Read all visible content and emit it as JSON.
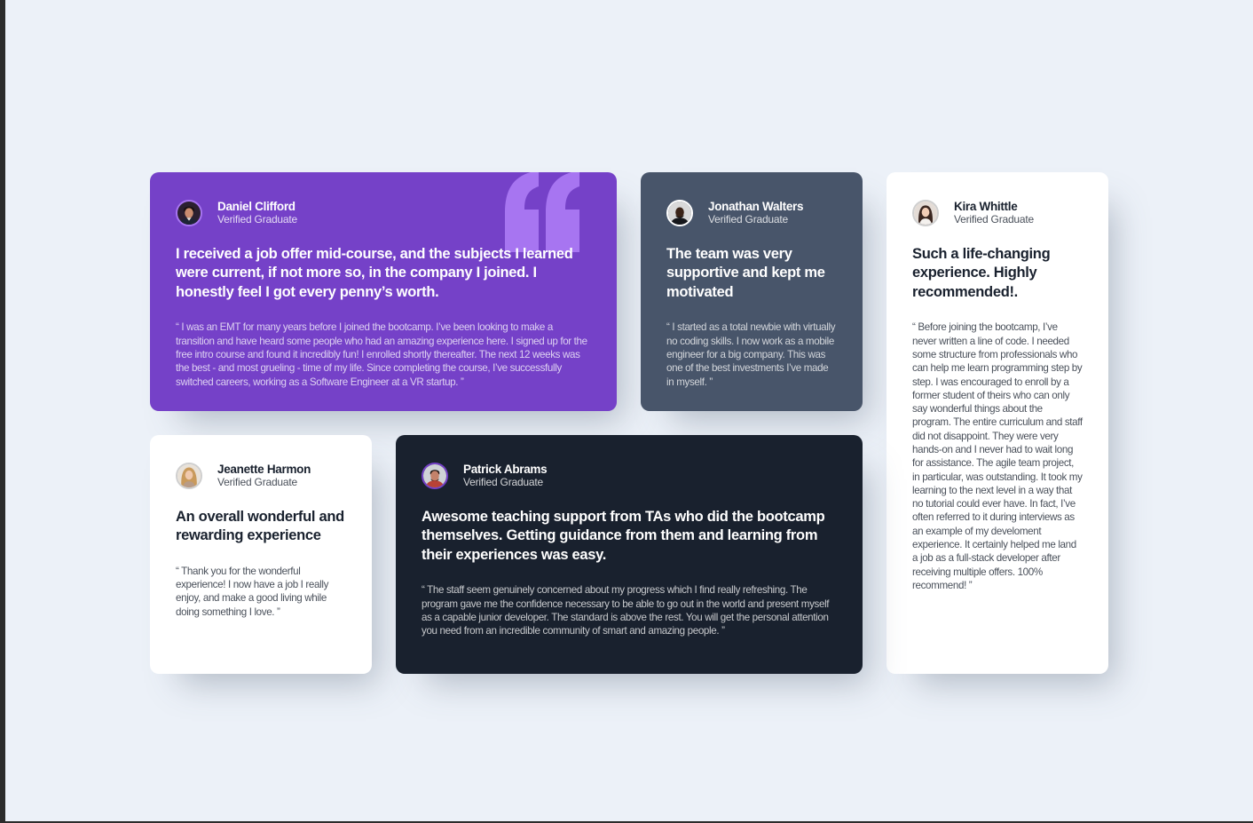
{
  "page": {
    "background": "#ecf1f8"
  },
  "colors": {
    "purple": "#7541c8",
    "grayish_blue": "#48556a",
    "dark_blackish_blue": "#19212e",
    "white": "#ffffff",
    "quote_mark": "#a775f1"
  },
  "testimonials": {
    "daniel": {
      "name": "Daniel Clifford",
      "role": "Verified Graduate",
      "headline": "I received a job offer mid-course, and the subjects I learned were current, if not more so, in the company I joined. I honestly feel I got every penny’s worth.",
      "body": "“ I was an EMT for many years before I joined the bootcamp. I’ve been looking to make a transition and have heard some people who had an amazing experience here. I signed up for the free intro course and found it incredibly fun! I enrolled shortly thereafter. The next 12 weeks was the best - and most grueling - time of my life. Since completing the course, I’ve successfully switched careers, working as a Software Engineer at a VR startup. ”",
      "avatar_icon": "avatar-daniel-icon"
    },
    "jonathan": {
      "name": "Jonathan Walters",
      "role": "Verified Graduate",
      "headline": "The team was very supportive and kept me motivated",
      "body": "“ I started as a total newbie with virtually no coding skills. I now work as a mobile engineer for a big company. This was one of the best investments I’ve made in myself. ”",
      "avatar_icon": "avatar-jonathan-icon"
    },
    "kira": {
      "name": "Kira Whittle",
      "role": "Verified Graduate",
      "headline": "Such a life-changing experience. Highly recommended!.",
      "body": "“ Before joining the bootcamp, I’ve never written a line of code. I needed some structure from professionals who can help me learn programming step by step. I was encouraged to enroll by a former student of theirs who can only say wonderful things about the program. The entire curriculum and staff did not disappoint. They were very hands-on and I never had to wait long for assistance. The agile team project, in particular, was outstanding. It took my learning to the next level in a way that no tutorial could ever have. In fact, I’ve often referred to it during interviews as an example of my develoment experience. It certainly helped me land a job as a full-stack developer after receiving multiple offers. 100% recommend! ”",
      "avatar_icon": "avatar-kira-icon"
    },
    "jeanette": {
      "name": "Jeanette Harmon",
      "role": "Verified Graduate",
      "headline": "An overall wonderful and rewarding experience",
      "body": "“ Thank you for the wonderful experience! I now have a job I really enjoy, and make a good living while doing something I love. ”",
      "avatar_icon": "avatar-jeanette-icon"
    },
    "patrick": {
      "name": "Patrick Abrams",
      "role": "Verified Graduate",
      "headline": "Awesome teaching support from TAs who did the bootcamp themselves. Getting guidance from them and learning from their experiences was easy.",
      "body": "“ The staff seem genuinely concerned about my progress which I find really refreshing. The program gave me the confidence necessary to be able to go out in the world and present myself as a capable junior developer. The standard is above the rest. You will get the personal attention you need from an incredible community of smart and amazing people. ”",
      "avatar_icon": "avatar-patrick-icon"
    }
  },
  "decorations": {
    "quote_icon": "quote-mark-icon"
  }
}
